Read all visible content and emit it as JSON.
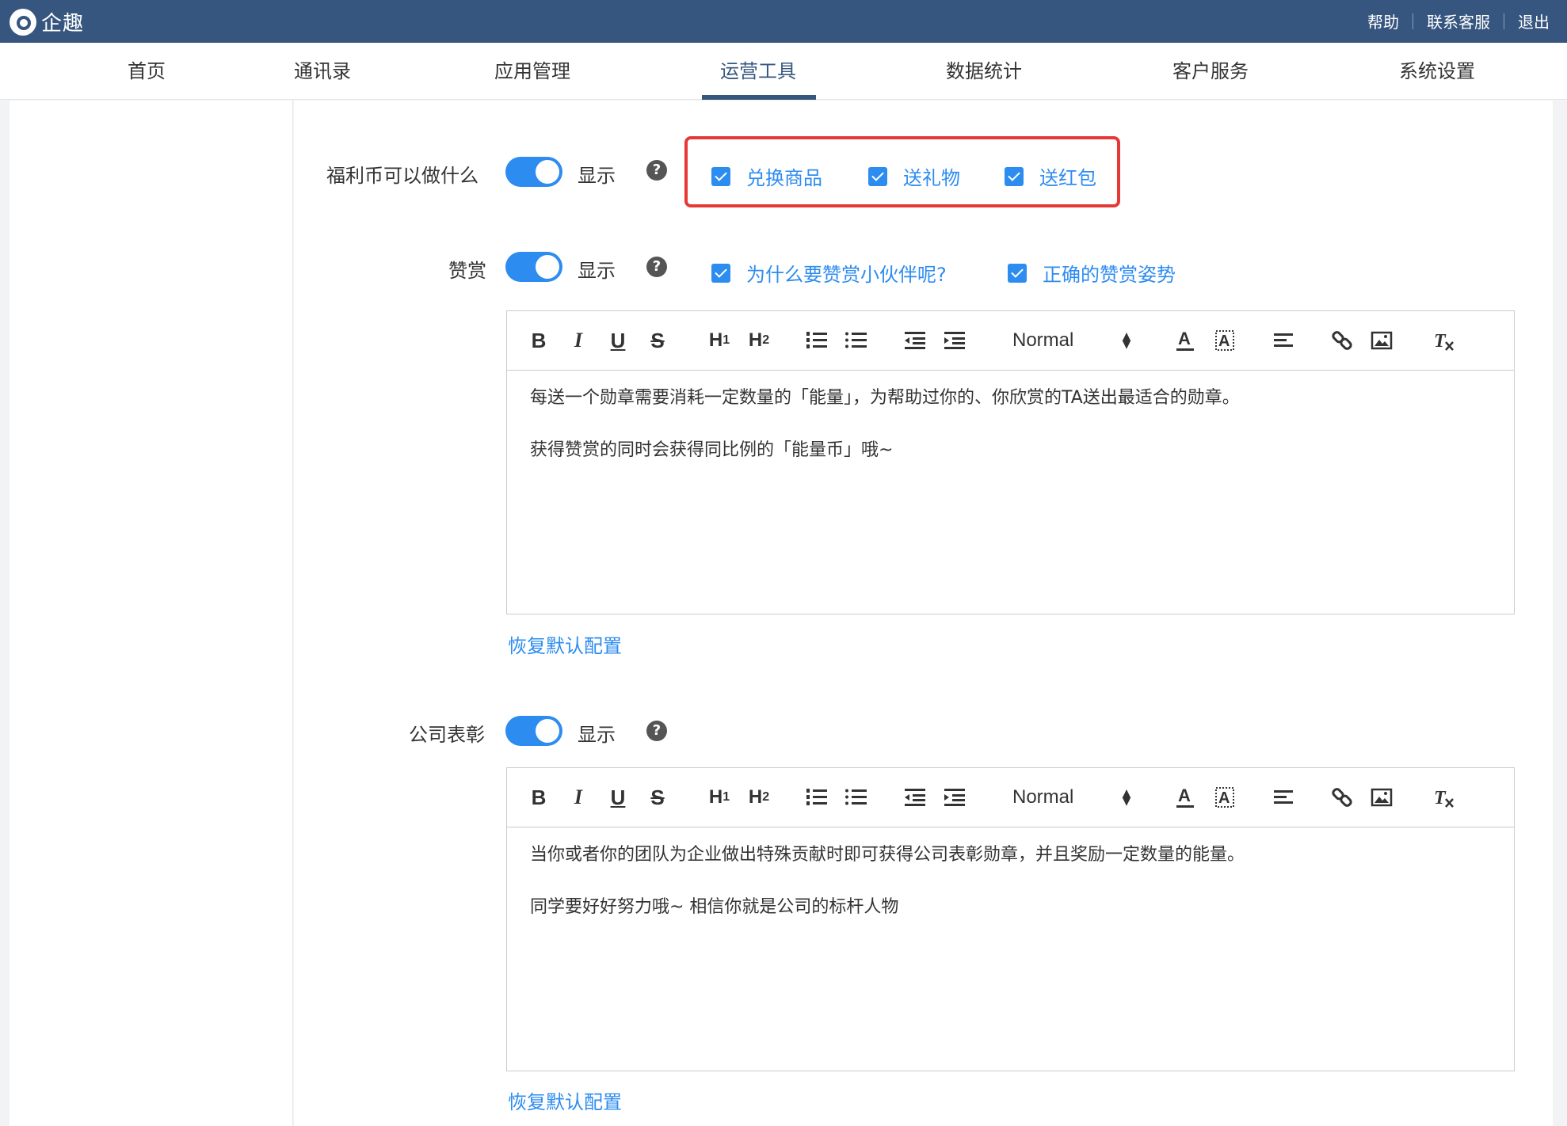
{
  "app": {
    "title": "企趣"
  },
  "top_links": [
    "帮助",
    "联系客服",
    "退出"
  ],
  "nav": {
    "items": [
      "首页",
      "通讯录",
      "应用管理",
      "运营工具",
      "数据统计",
      "客户服务",
      "系统设置"
    ],
    "active": "运营工具"
  },
  "sections": {
    "welfare": {
      "label": "福利币可以做什么",
      "toggle_on": true,
      "toggle_text": "显示",
      "help": "?",
      "options": [
        "兑换商品",
        "送礼物",
        "送红包"
      ]
    },
    "praise": {
      "label": "赞赏",
      "toggle_on": true,
      "toggle_text": "显示",
      "help": "?",
      "options": [
        "为什么要赞赏小伙伴呢?",
        "正确的赞赏姿势"
      ],
      "editor": {
        "format": "Normal",
        "paragraphs": [
          "每送一个勋章需要消耗一定数量的「能量」，为帮助过你的、你欣赏的TA送出最适合的勋章。",
          "获得赞赏的同时会获得同比例的「能量币」哦~"
        ]
      },
      "restore": "恢复默认配置"
    },
    "company": {
      "label": "公司表彰",
      "toggle_on": true,
      "toggle_text": "显示",
      "help": "?",
      "editor": {
        "format": "Normal",
        "paragraphs": [
          "当你或者你的团队为企业做出特殊贡献时即可获得公司表彰勋章，并且奖励一定数量的能量。",
          "同学要好好努力哦~ 相信你就是公司的标杆人物"
        ]
      },
      "restore": "恢复默认配置"
    }
  },
  "toolbar": {
    "bold": "B",
    "italic": "I",
    "underline": "U",
    "strike": "S",
    "h1": "H",
    "h1_sub": "1",
    "h2": "H",
    "h2_sub": "2",
    "format": "Normal"
  },
  "colors": {
    "topbar": "#36567f",
    "accent": "#2d8cf0",
    "highlight": "#e53935"
  }
}
